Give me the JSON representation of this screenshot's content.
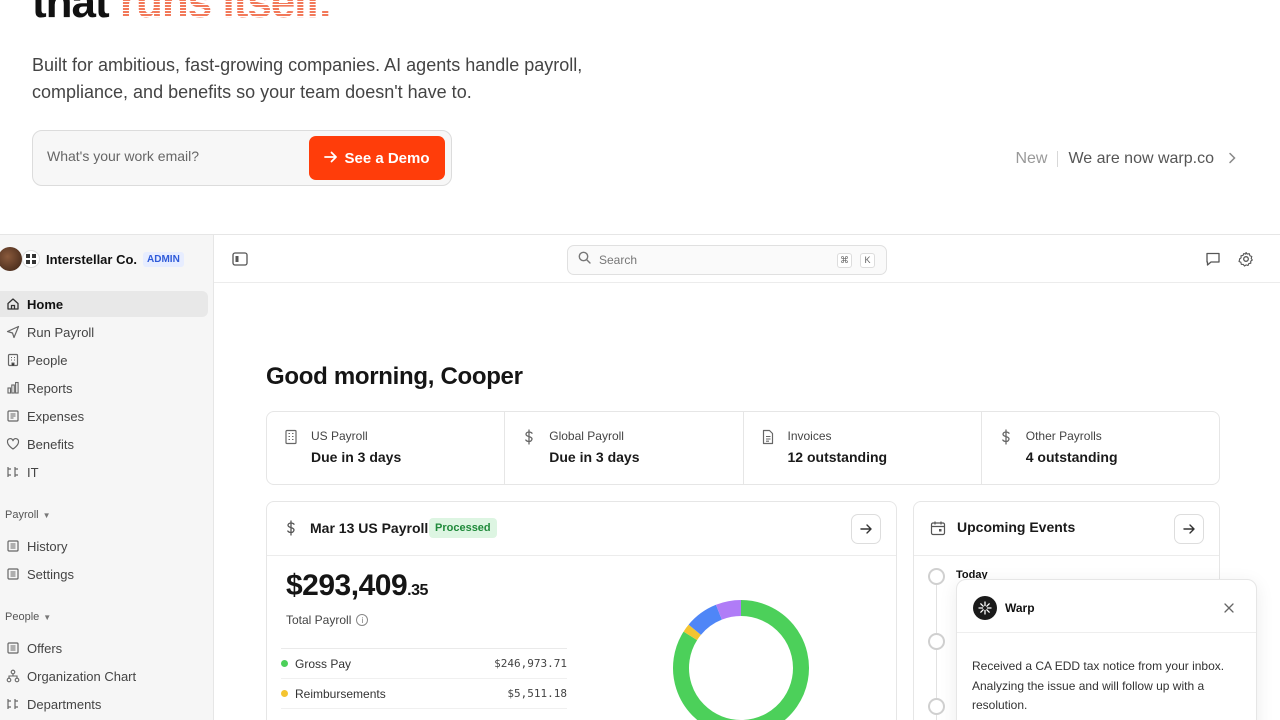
{
  "hero": {
    "title_prefix": "that",
    "title_accent": "runs itself.",
    "subtitle": "Built for ambitious, fast-growing companies. AI agents handle payroll, compliance, and benefits so your team doesn't have to.",
    "email_placeholder": "What's your work email?",
    "demo_button": "See a Demo",
    "announce_new": "New",
    "announce_text": "We are now warp.co"
  },
  "colors": {
    "brand_orange": "#ff3d0a",
    "processed_green": "#1f8a3a"
  },
  "sidebar": {
    "org_name": "Interstellar Co.",
    "admin_badge": "ADMIN",
    "items": [
      {
        "label": "Home",
        "icon": "home-icon",
        "active": true
      },
      {
        "label": "Run Payroll",
        "icon": "send-icon"
      },
      {
        "label": "People",
        "icon": "building-icon"
      },
      {
        "label": "Reports",
        "icon": "bar-chart-icon"
      },
      {
        "label": "Expenses",
        "icon": "receipt-icon"
      },
      {
        "label": "Benefits",
        "icon": "heart-icon"
      },
      {
        "label": "IT",
        "icon": "laptop-icon"
      }
    ],
    "payroll_section": {
      "label": "Payroll",
      "items": [
        {
          "label": "History",
          "icon": "history-icon"
        },
        {
          "label": "Settings",
          "icon": "settings-icon"
        }
      ]
    },
    "people_section": {
      "label": "People",
      "items": [
        {
          "label": "Offers",
          "icon": "document-icon"
        },
        {
          "label": "Organization Chart",
          "icon": "org-chart-icon"
        },
        {
          "label": "Departments",
          "icon": "departments-icon"
        }
      ]
    }
  },
  "topbar": {
    "search_placeholder": "Search",
    "shortcut_cmd": "⌘",
    "shortcut_key": "K"
  },
  "main": {
    "greeting": "Good morning, Cooper",
    "stats": [
      {
        "label": "US Payroll",
        "value": "Due in 3 days",
        "icon": "building-icon"
      },
      {
        "label": "Global Payroll",
        "value": "Due in 3 days",
        "icon": "dollar-icon"
      },
      {
        "label": "Invoices",
        "value": "12 outstanding",
        "icon": "document-icon"
      },
      {
        "label": "Other Payrolls",
        "value": "4 outstanding",
        "icon": "dollar-icon"
      }
    ],
    "payroll_card": {
      "title": "Mar 13 US Payroll",
      "status": "Processed",
      "amount_main": "$293,409",
      "amount_cents": ".35",
      "total_label": "Total Payroll",
      "breakdown": [
        {
          "label": "Gross Pay",
          "value": "$246,973.71",
          "color": "#4cd05a"
        },
        {
          "label": "Reimbursements",
          "value": "$5,511.18",
          "color": "#f4c430"
        }
      ]
    },
    "events_card": {
      "title": "Upcoming Events",
      "first_group": "Today"
    }
  },
  "chart_data": {
    "type": "pie",
    "variant": "donut",
    "segments": [
      {
        "label": "Gross Pay",
        "share": 0.84,
        "color": "#4cd05a"
      },
      {
        "label": "Reimbursements",
        "share": 0.02,
        "color": "#f4c430"
      },
      {
        "label": "",
        "share": 0.08,
        "color": "#4f86f7"
      },
      {
        "label": "",
        "share": 0.06,
        "color": "#b07cf7"
      }
    ]
  },
  "notification": {
    "sender": "Warp",
    "message": "Received a CA EDD tax notice from your inbox. Analyzing the issue and will follow up with a resolution."
  }
}
